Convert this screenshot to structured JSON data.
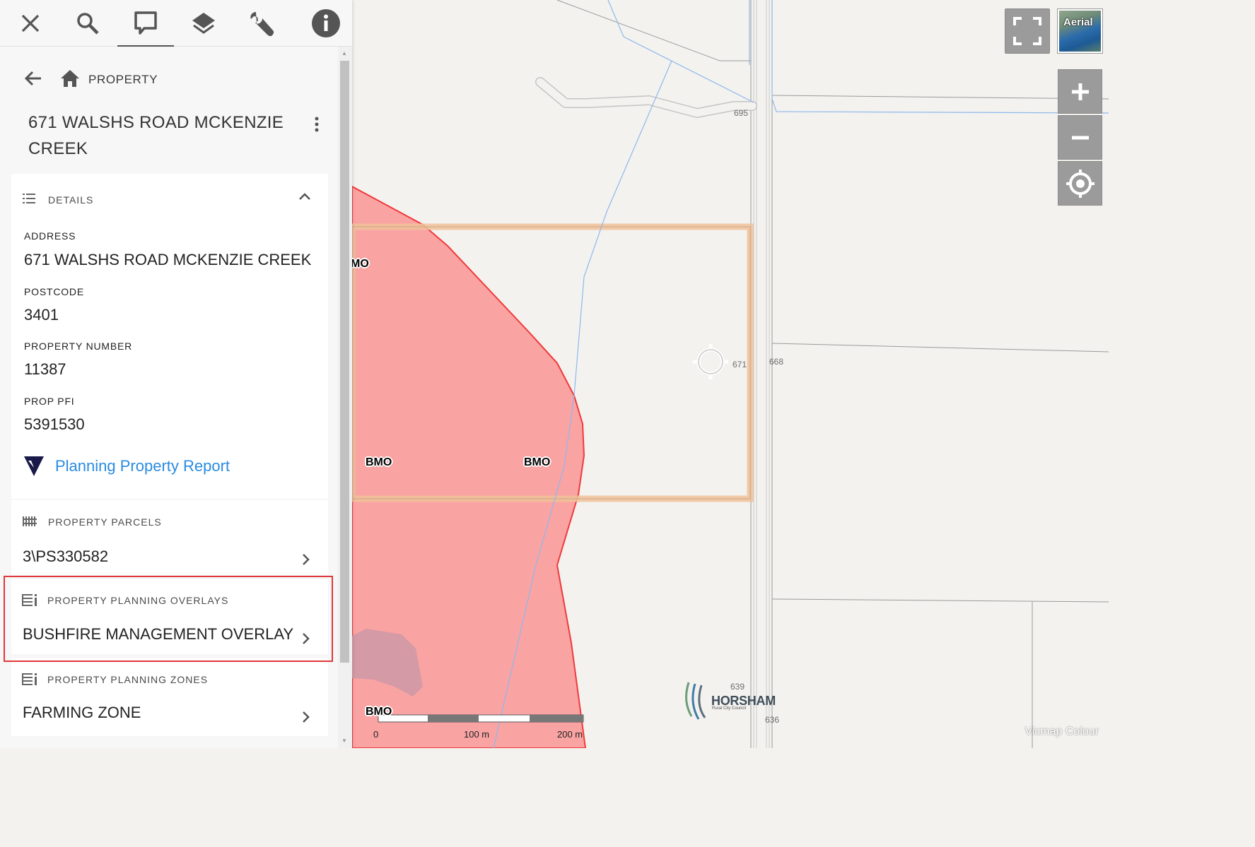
{
  "toolbar": {
    "tools": [
      {
        "name": "close-icon",
        "active": false
      },
      {
        "name": "search-icon",
        "active": false
      },
      {
        "name": "identify-icon",
        "active": true
      },
      {
        "name": "layers-icon",
        "active": false
      },
      {
        "name": "wrench-icon",
        "active": false
      },
      {
        "name": "info-icon",
        "active": false
      }
    ]
  },
  "nav": {
    "title": "PROPERTY"
  },
  "property": {
    "title": "671 WALSHS ROAD MCKENZIE CREEK"
  },
  "details": {
    "header": "DETAILS",
    "fields": [
      {
        "label": "ADDRESS",
        "value": "671 WALSHS ROAD MCKENZIE CREEK"
      },
      {
        "label": "POSTCODE",
        "value": "3401"
      },
      {
        "label": "PROPERTY NUMBER",
        "value": "11387"
      },
      {
        "label": "PROP PFI",
        "value": "5391530"
      }
    ],
    "report_link": "Planning Property Report"
  },
  "parcels": {
    "header": "PROPERTY PARCELS",
    "value": "3\\PS330582"
  },
  "overlays": {
    "header": "PROPERTY PLANNING OVERLAYS",
    "value": "BUSHFIRE MANAGEMENT OVERLAY"
  },
  "zones": {
    "header": "PROPERTY PLANNING ZONES",
    "value": "FARMING ZONE"
  },
  "map": {
    "labels": {
      "n695": "695",
      "n671": "671",
      "n668": "668",
      "n639": "639",
      "n636": "636",
      "bmo_partial": "MO",
      "bmo": "BMO"
    },
    "aerial_label": "Aerial",
    "scale": {
      "zero": "0",
      "mid": "100 m",
      "max": "200 m"
    },
    "logo": {
      "name": "HORSHAM",
      "sub": "Rural City Council"
    },
    "attribution": "Vicmap Colour",
    "colors": {
      "overlay_fill": "#f9a3a3",
      "overlay_stroke": "#f03a3a",
      "parcel_highlight": "#f1c29a",
      "river": "#8fb8ec"
    }
  }
}
